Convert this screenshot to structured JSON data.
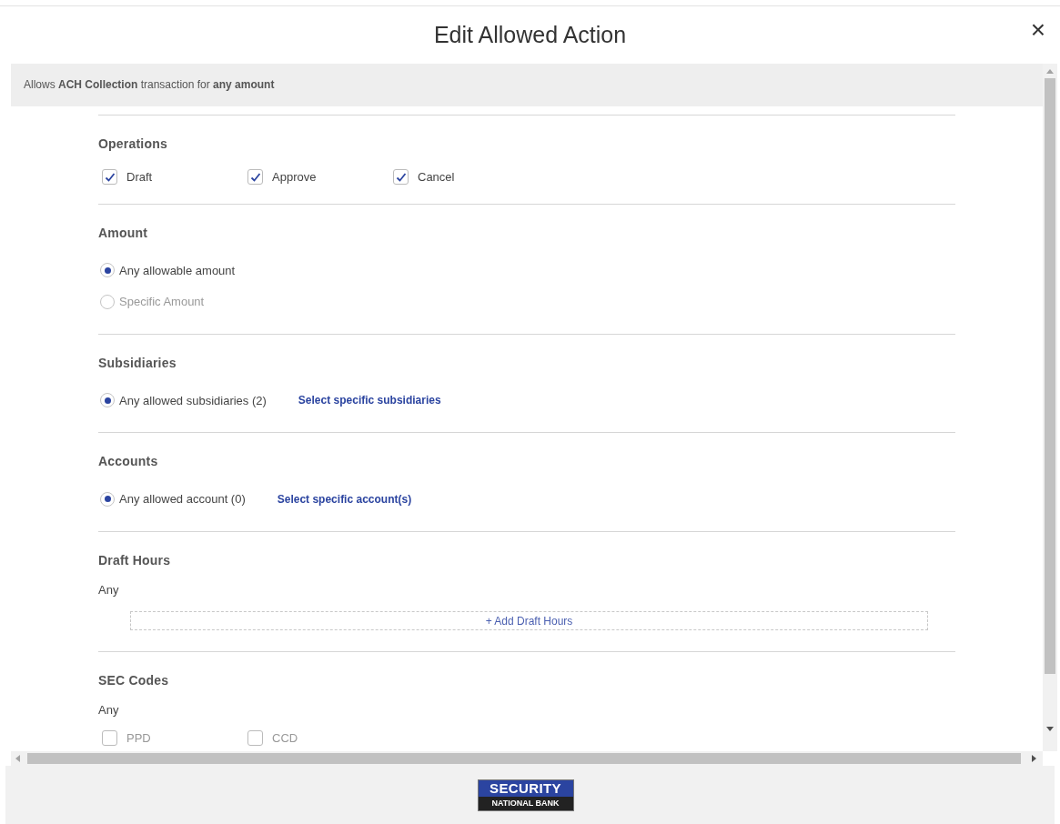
{
  "dialog": {
    "title": "Edit Allowed Action",
    "close": "×"
  },
  "summary": "Allows **ACH Collection** transaction for **any amount**",
  "sections": [
    {
      "kind": "checkboxes",
      "title": "Operations",
      "options": [
        {
          "label": "Draft",
          "checked": true
        },
        {
          "label": "Approve",
          "checked": true
        },
        {
          "label": "Cancel",
          "checked": true
        }
      ]
    },
    {
      "kind": "radios",
      "title": "Amount",
      "options": [
        {
          "label": "Any allowable amount",
          "selected": true,
          "disabled": false
        },
        {
          "label": "Specific Amount",
          "selected": false,
          "disabled": true
        }
      ]
    },
    {
      "kind": "radios",
      "title": "Subsidiaries",
      "options": [
        {
          "label": "Any allowed subsidiaries (2)",
          "selected": true,
          "disabled": false
        }
      ],
      "link": "Select specific subsidiaries"
    },
    {
      "kind": "radios",
      "title": "Accounts",
      "options": [
        {
          "label": "Any allowed account (0)",
          "selected": true,
          "disabled": false
        }
      ],
      "link": "Select specific account(s)"
    },
    {
      "kind": "hours",
      "title": "Draft Hours",
      "value": "Any",
      "add_button": "+ Add Draft Hours"
    },
    {
      "kind": "codes",
      "title": "SEC Codes",
      "value": "Any",
      "options": [
        {
          "label": "PPD",
          "checked": false
        },
        {
          "label": "CCD",
          "checked": false
        }
      ]
    }
  ],
  "footer": {
    "logo_top": "SECURITY",
    "logo_bottom": "NATIONAL BANK"
  }
}
